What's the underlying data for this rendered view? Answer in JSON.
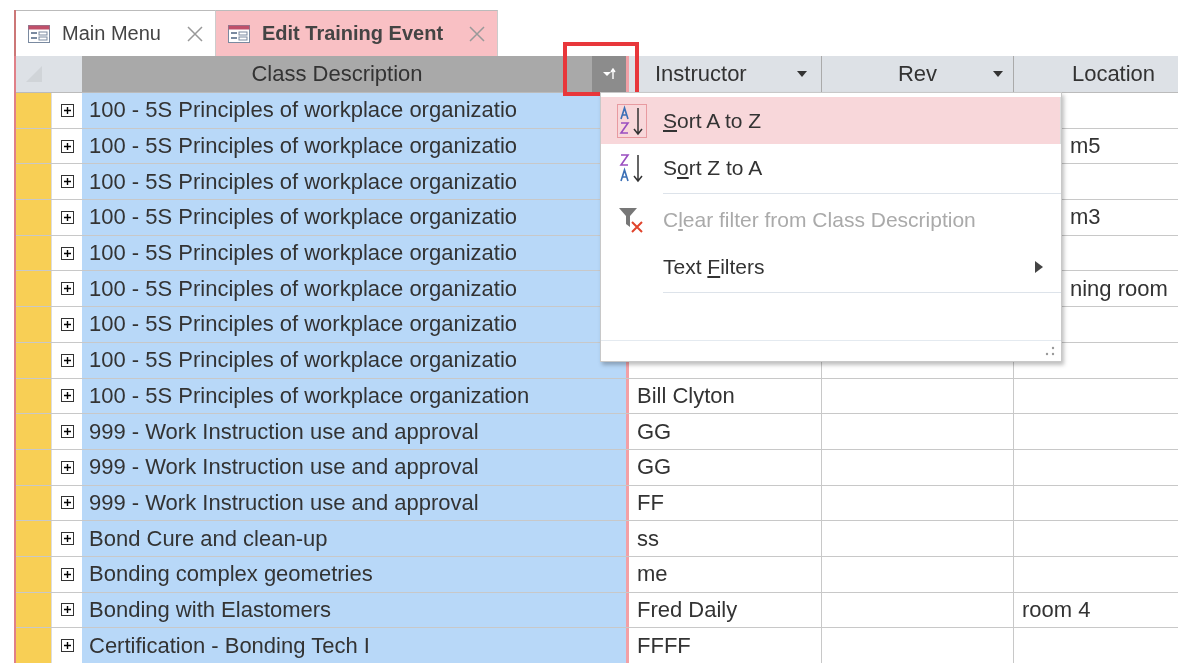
{
  "tabs": [
    {
      "label": "Main Menu",
      "selected": false
    },
    {
      "label": "Edit Training Event",
      "selected": true
    }
  ],
  "columns": [
    {
      "label": "Class Description",
      "kind": "filter-open"
    },
    {
      "label": "Instructor",
      "kind": "left"
    },
    {
      "label": "Rev",
      "kind": "center"
    },
    {
      "label": "Location",
      "kind": "clipped"
    }
  ],
  "rows": [
    {
      "class": "100 - 5S Principles of workplace organizatio"
    },
    {
      "class": "100 - 5S Principles of workplace organizatio",
      "location": "m5",
      "under_menu": true
    },
    {
      "class": "100 - 5S Principles of workplace organizatio"
    },
    {
      "class": "100 - 5S Principles of workplace organizatio",
      "location": "m3",
      "under_menu": true
    },
    {
      "class": "100 - 5S Principles of workplace organizatio"
    },
    {
      "class": "100 - 5S Principles of workplace organizatio",
      "location": "ning room",
      "under_menu": true
    },
    {
      "class": "100 - 5S Principles of workplace organizatio"
    },
    {
      "class": "100 - 5S Principles of workplace organizatio"
    },
    {
      "class": "100 - 5S Principles of workplace organization",
      "instructor": "Bill Clyton"
    },
    {
      "class": "999 - Work Instruction use and approval",
      "instructor": "GG"
    },
    {
      "class": "999 - Work Instruction use and approval",
      "instructor": "GG"
    },
    {
      "class": "999 - Work Instruction use and approval",
      "instructor": "FF"
    },
    {
      "class": "Bond Cure and clean-up",
      "instructor": "ss"
    },
    {
      "class": "Bonding complex geometries",
      "instructor": "me"
    },
    {
      "class": "Bonding with Elastomers",
      "instructor": "Fred Daily",
      "location": "room 4",
      "under_menu": false
    },
    {
      "class": "Certification - Bonding  Tech I",
      "instructor": "FFFF"
    }
  ],
  "menu": {
    "items": [
      {
        "kind": "sort-asc",
        "key": "S",
        "after": "ort A to Z",
        "selected": true,
        "disabled": false
      },
      {
        "kind": "sort-desc",
        "before": "S",
        "key": "o",
        "after": "rt Z to A",
        "selected": false,
        "disabled": false
      },
      {
        "kind": "clear-filter",
        "before": "C",
        "key": "l",
        "after": "ear filter from Class Description",
        "selected": false,
        "disabled": true
      },
      {
        "kind": "submenu",
        "before": "Text ",
        "key": "F",
        "after": "ilters",
        "selected": false,
        "disabled": false
      }
    ]
  }
}
